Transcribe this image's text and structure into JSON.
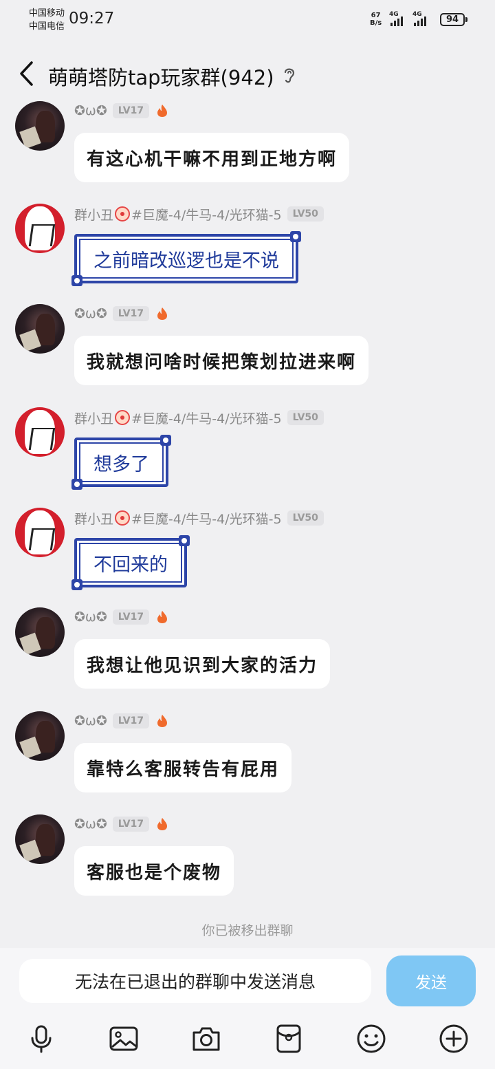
{
  "status_bar": {
    "carrier_1": "中国移动",
    "carrier_2": "中国电信",
    "time": "09:27",
    "net_speed_value": "67",
    "net_speed_unit": "B/s",
    "signal_1_label": "4G",
    "signal_2_label": "4G",
    "battery": "94"
  },
  "header": {
    "title": "萌萌塔防tap玩家群(942)",
    "icons": [
      "back-icon",
      "ear-icon"
    ]
  },
  "messages": [
    {
      "sender": "✪ω✪",
      "level": "LV17",
      "text": "有这心机干嘛不用到正地方啊",
      "style": "plain"
    },
    {
      "sender_prefix": "群小丑",
      "sender_suffix": "#巨魔-4/牛马-4/光环猫-5",
      "level": "LV50",
      "text": "之前暗改巡逻也是不说",
      "style": "fancy"
    },
    {
      "sender": "✪ω✪",
      "level": "LV17",
      "text": "我就想问啥时候把策划拉进来啊",
      "style": "plain"
    },
    {
      "sender_prefix": "群小丑",
      "sender_suffix": "#巨魔-4/牛马-4/光环猫-5",
      "level": "LV50",
      "text": "想多了",
      "style": "fancy"
    },
    {
      "sender_prefix": "群小丑",
      "sender_suffix": "#巨魔-4/牛马-4/光环猫-5",
      "level": "LV50",
      "text": "不回来的",
      "style": "fancy"
    },
    {
      "sender": "✪ω✪",
      "level": "LV17",
      "text": "我想让他见识到大家的活力",
      "style": "plain"
    },
    {
      "sender": "✪ω✪",
      "level": "LV17",
      "text": "靠特么客服转告有屁用",
      "style": "plain"
    },
    {
      "sender": "✪ω✪",
      "level": "LV17",
      "text": "客服也是个废物",
      "style": "plain"
    }
  ],
  "system_notice": "你已被移出群聊",
  "input": {
    "text": "无法在已退出的群聊中发送消息",
    "send_label": "发送"
  },
  "toolbar_icons": [
    "microphone-icon",
    "image-icon",
    "camera-icon",
    "red-packet-icon",
    "emoji-icon",
    "plus-icon"
  ],
  "colors": {
    "background": "#f0f0f2",
    "send_button": "#7fc7f4",
    "fancy_bubble_border": "#2d45a8",
    "fancy_bubble_text": "#1f3a9a",
    "fire": "#f06a2c"
  }
}
